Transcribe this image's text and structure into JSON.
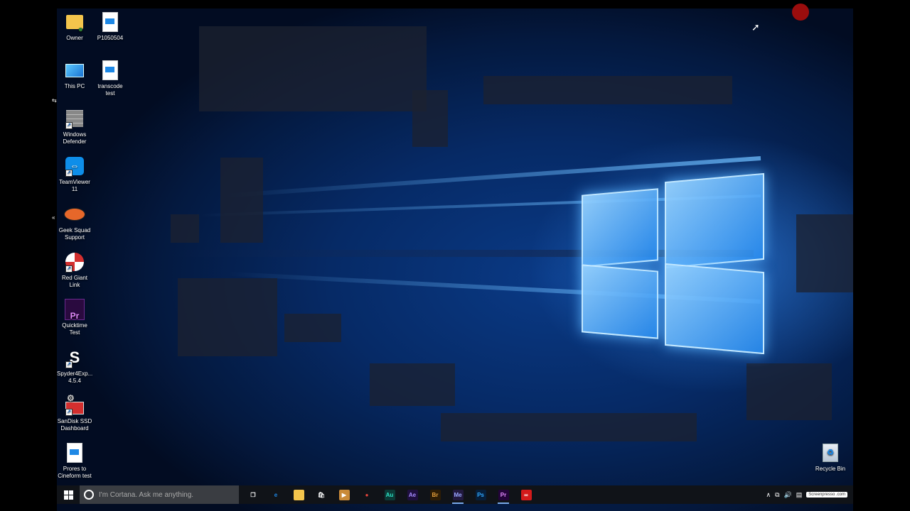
{
  "desktop": {
    "icons": [
      {
        "label": "Owner",
        "icon": "user-folder-icon"
      },
      {
        "label": "P1050504",
        "icon": "video-file-icon"
      },
      {
        "label": "This PC",
        "icon": "monitor-icon"
      },
      {
        "label": "transcode test",
        "icon": "video-file-icon"
      },
      {
        "label": "Windows Defender",
        "icon": "defender-icon"
      },
      {
        "label": "TeamViewer 11",
        "icon": "teamviewer-icon"
      },
      {
        "label": "Geek Squad Support",
        "icon": "geek-squad-icon"
      },
      {
        "label": "Red Giant Link",
        "icon": "red-giant-icon"
      },
      {
        "label": "Quicktime Test",
        "icon": "premiere-project-icon"
      },
      {
        "label": "Spyder4Exp... 4.5.4",
        "icon": "spyder-icon"
      },
      {
        "label": "SanDisk SSD Dashboard",
        "icon": "sandisk-icon"
      },
      {
        "label": "Prores to Cineform test",
        "icon": "video-file-icon"
      },
      {
        "label": "Recycle Bin",
        "icon": "recycle-bin-icon"
      }
    ]
  },
  "taskbar": {
    "search_placeholder": "I'm Cortana. Ask me anything.",
    "apps": [
      {
        "name": "task-view",
        "glyph": "❐",
        "bg": "transparent",
        "color": "#ffffff"
      },
      {
        "name": "edge",
        "glyph": "e",
        "bg": "transparent",
        "color": "#1e88e5"
      },
      {
        "name": "file-explorer",
        "glyph": "▬",
        "bg": "#f4c54c",
        "color": "#f4c54c"
      },
      {
        "name": "store",
        "glyph": "🛍",
        "bg": "transparent",
        "color": "#ffffff"
      },
      {
        "name": "media-player",
        "glyph": "▶",
        "bg": "#c98a38",
        "color": "#ffffff"
      },
      {
        "name": "chrome",
        "glyph": "●",
        "bg": "transparent",
        "color": "#e8453c"
      },
      {
        "name": "audition",
        "glyph": "Au",
        "bg": "#0b3a36",
        "color": "#2ee3c5"
      },
      {
        "name": "after-effects",
        "glyph": "Ae",
        "bg": "#1f0f3f",
        "color": "#a68cff"
      },
      {
        "name": "bridge",
        "glyph": "Br",
        "bg": "#2d1c05",
        "color": "#e8a13c"
      },
      {
        "name": "media-encoder",
        "glyph": "Me",
        "bg": "#22193f",
        "color": "#9aa7ff"
      },
      {
        "name": "photoshop",
        "glyph": "Ps",
        "bg": "#061e3a",
        "color": "#31a8ff"
      },
      {
        "name": "premiere",
        "glyph": "Pr",
        "bg": "#23033a",
        "color": "#e58cff"
      },
      {
        "name": "creative-cloud",
        "glyph": "∞",
        "bg": "#d31b1b",
        "color": "#ffffff"
      }
    ],
    "active_apps": [
      "media-encoder",
      "premiere"
    ],
    "tray": {
      "chevron": "∧",
      "network": "⧉",
      "volume": "🔊",
      "message": "▤",
      "watermark": "Screenpresso .com"
    }
  },
  "colors": {
    "taskbar": "#101318",
    "accent": "#1e88e5",
    "record_dot": "#9b0d0d"
  }
}
